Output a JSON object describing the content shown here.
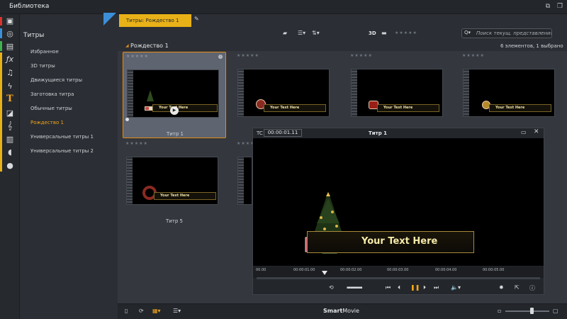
{
  "window": {
    "title": "Библиотека",
    "buttons": [
      "⧉",
      "❐"
    ]
  },
  "rail": {
    "icons": [
      {
        "name": "camera-reel-icon",
        "glyph": "▣"
      },
      {
        "name": "disc-icon",
        "glyph": "◎"
      },
      {
        "name": "stack-icon",
        "glyph": "▤"
      },
      {
        "name": "fx-icon",
        "glyph": "ƒx"
      },
      {
        "name": "music-note-icon",
        "glyph": "♫"
      },
      {
        "name": "lightning-icon",
        "glyph": "ϟ"
      },
      {
        "name": "title-t-icon",
        "glyph": "T"
      },
      {
        "name": "transition-icon",
        "glyph": "◪"
      },
      {
        "name": "treble-clef-icon",
        "glyph": "𝄞"
      },
      {
        "name": "film-strip-icon",
        "glyph": "▥"
      },
      {
        "name": "audio-wave-icon",
        "glyph": "◖"
      },
      {
        "name": "record-icon",
        "glyph": "●"
      }
    ],
    "strip_colors": [
      "#d9342b",
      "#3b8fd9",
      "#3fb34f",
      "#e8b118"
    ]
  },
  "nav": {
    "heading": "Титры",
    "items": [
      {
        "label": "Избранное"
      },
      {
        "label": "3D титры"
      },
      {
        "label": "Движущиеся титры"
      },
      {
        "label": "Заготовка титра"
      },
      {
        "label": "Обычные титры"
      },
      {
        "label": "Рождество 1"
      },
      {
        "label": "Универсальные титры 1"
      },
      {
        "label": "Универсальные титры 2"
      }
    ],
    "active_index": 5
  },
  "tab": {
    "title": "Титры: Рождество 1",
    "pin_icon": "✎"
  },
  "toolbar": {
    "folder_icon": "▰",
    "list_icon": "☰▾",
    "sort_icon": "⇅▾",
    "three_d": "3D",
    "view_icon": "▬",
    "stars": "★★★★★",
    "search_icon": "Q▾",
    "search_placeholder": "Поиск текущ. представления"
  },
  "group": {
    "arrow": "◢",
    "name": "Рождество 1",
    "count": "6 элементов, 1 выбрано"
  },
  "cards": [
    {
      "label": "Титр 1",
      "stars": "★★★★★",
      "text": "Your Text Here"
    },
    {
      "label": "",
      "stars": "★★★★★",
      "text": "Your Text Here"
    },
    {
      "label": "",
      "stars": "★★★★★",
      "text": "Your Text Here"
    },
    {
      "label": "",
      "stars": "★★★★★",
      "text": "Your Text Here"
    },
    {
      "label": "Титр 5",
      "stars": "★★★★★",
      "text": "Your Text Here"
    },
    {
      "label": "",
      "stars": "★★★★★",
      "text": ""
    }
  ],
  "player": {
    "tc_label": "TC",
    "timecode": "00:00:01.11",
    "title": "Титр 1",
    "restore_icon": "▭",
    "close_icon": "✕",
    "banner_text": "Your Text Here",
    "ticks": [
      "00.00",
      "00:00:01.00",
      "00:00:02.00",
      "00:00:03.00",
      "00:00:04.00",
      "00:00:05.00"
    ],
    "playhead_seconds": 1.44,
    "controls": {
      "loop": "⟲",
      "shuttle": "▪▪▪▪▪▪▪▪▪",
      "to_start": "⏮",
      "step_back": "⏴",
      "pause": "❚❚",
      "step_fwd": "⏵",
      "to_end": "⏭",
      "volume": "🔈▾",
      "settings": "✹",
      "export": "⇱",
      "info": "ⓘ"
    }
  },
  "bottombar": {
    "icons": {
      "library": "▯",
      "refresh": "⟳",
      "grid": "▦▾",
      "list": "☰▾"
    },
    "brand_smart": "Smart",
    "brand_movie": "Movie",
    "zoom_min": "▫",
    "zoom_max": "▢",
    "zoom_level": 0.6
  }
}
